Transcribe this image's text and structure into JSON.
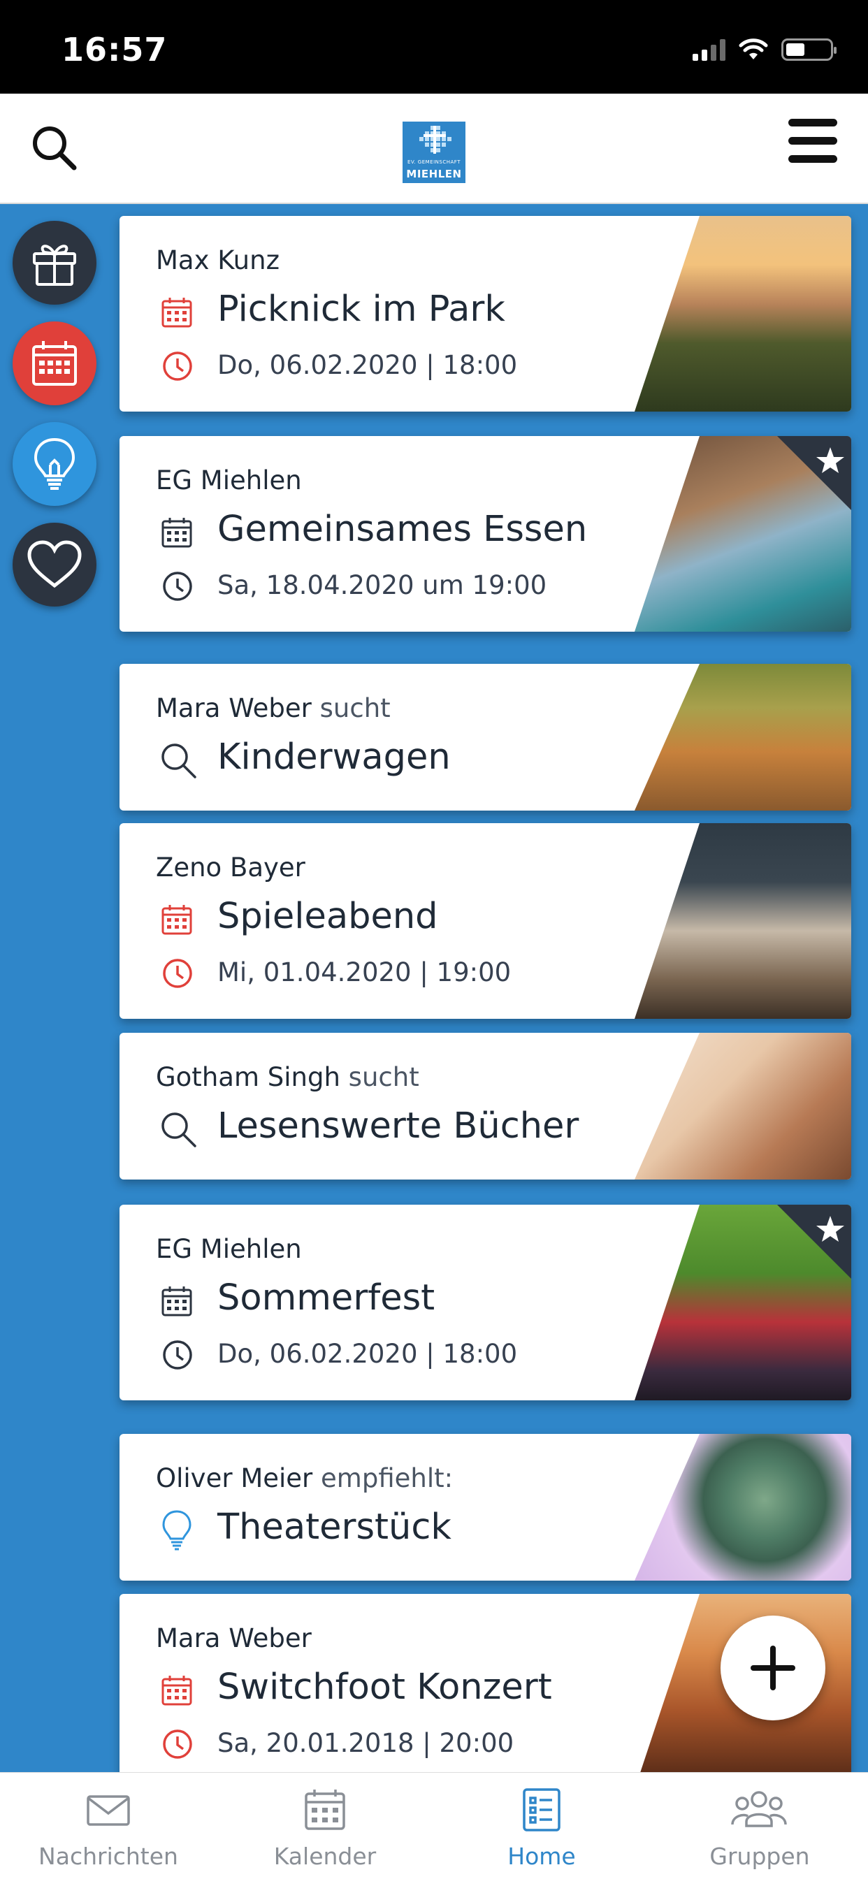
{
  "status_bar": {
    "time": "16:57"
  },
  "header": {
    "logo_line1": "EV. GEMEINSCHAFT",
    "logo_line2": "MIEHLEN"
  },
  "colors": {
    "accent": "#2f86c9",
    "red": "#e0403a",
    "dark": "#2c3440"
  },
  "side_buttons": [
    {
      "icon": "gift-icon",
      "color": "#2c3440"
    },
    {
      "icon": "calendar-icon",
      "color": "#e0403a"
    },
    {
      "icon": "lightbulb-icon",
      "color": "#2f95dd"
    },
    {
      "icon": "heart-icon",
      "color": "#2c3440"
    }
  ],
  "cards": [
    {
      "name": "Max Kunz",
      "verb": "",
      "title": "Picknick im Park",
      "date": "Do, 06.02.2020 | 18:00",
      "type": "event",
      "accent": "red",
      "starred": false
    },
    {
      "name": "EG Miehlen",
      "verb": "",
      "title": "Gemeinsames Essen",
      "date": "Sa, 18.04.2020 um 19:00",
      "type": "event",
      "accent": "dark",
      "starred": true
    },
    {
      "name": "Mara Weber",
      "verb": "sucht",
      "title": "Kinderwagen",
      "date": "",
      "type": "search",
      "accent": "dark",
      "starred": false
    },
    {
      "name": "Zeno Bayer",
      "verb": "",
      "title": "Spieleabend",
      "date": "Mi, 01.04.2020 | 19:00",
      "type": "event",
      "accent": "red",
      "starred": false
    },
    {
      "name": "Gotham Singh",
      "verb": "sucht",
      "title": "Lesenswerte Bücher",
      "date": "",
      "type": "search",
      "accent": "dark",
      "starred": false
    },
    {
      "name": "EG Miehlen",
      "verb": "",
      "title": "Sommerfest",
      "date": "Do, 06.02.2020 | 18:00",
      "type": "event",
      "accent": "dark",
      "starred": true
    },
    {
      "name": "Oliver Meier",
      "verb": "empfiehlt:",
      "title": "Theaterstück",
      "date": "",
      "type": "tip",
      "accent": "blue",
      "starred": false
    },
    {
      "name": "Mara Weber",
      "verb": "",
      "title": "Switchfoot Konzert",
      "date": "Sa, 20.01.2018 | 20:00",
      "type": "event",
      "accent": "red",
      "starred": false
    }
  ],
  "tabs": [
    {
      "label": "Nachrichten",
      "icon": "envelope-icon",
      "active": false
    },
    {
      "label": "Kalender",
      "icon": "calendar-icon",
      "active": false
    },
    {
      "label": "Home",
      "icon": "list-icon",
      "active": true
    },
    {
      "label": "Gruppen",
      "icon": "group-icon",
      "active": false
    }
  ]
}
